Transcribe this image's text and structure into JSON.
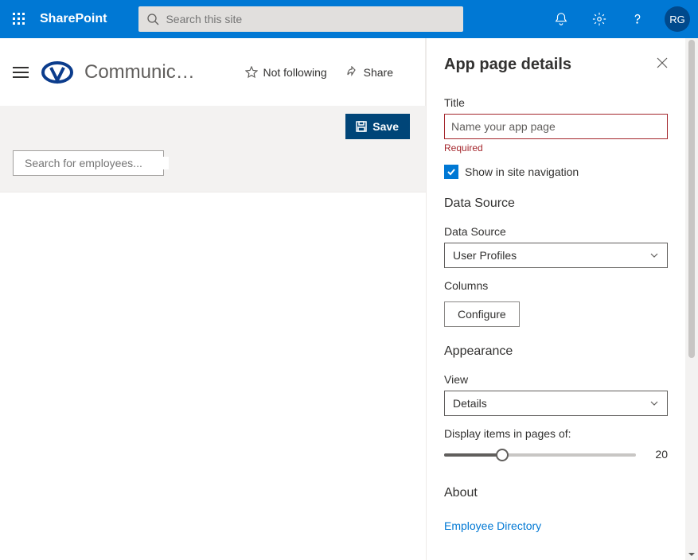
{
  "header": {
    "brand": "SharePoint",
    "search_placeholder": "Search this site",
    "avatar_initials": "RG"
  },
  "site": {
    "title": "Communicati…",
    "not_following": "Not following",
    "share": "Share"
  },
  "canvas": {
    "save_label": "Save",
    "emp_search_placeholder": "Search for employees..."
  },
  "panel": {
    "title": "App page details",
    "title_field_label": "Title",
    "title_placeholder": "Name your app page",
    "required": "Required",
    "show_nav_label": "Show in site navigation",
    "data_source_section": "Data Source",
    "data_source_label": "Data Source",
    "data_source_value": "User Profiles",
    "columns_label": "Columns",
    "configure_label": "Configure",
    "appearance_section": "Appearance",
    "view_label": "View",
    "view_value": "Details",
    "pages_label": "Display items in pages of:",
    "pages_value": "20",
    "about_section": "About",
    "about_link": "Employee Directory"
  }
}
